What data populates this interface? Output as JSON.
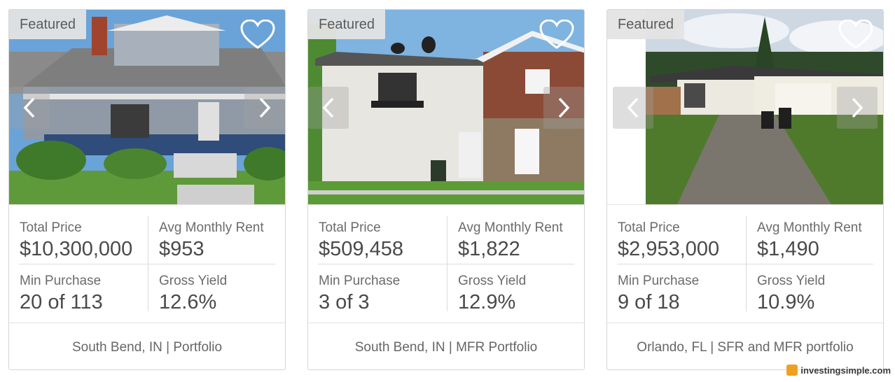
{
  "cards": [
    {
      "badge": "Featured",
      "total_price_label": "Total Price",
      "total_price": "$10,300,000",
      "rent_label": "Avg Monthly Rent",
      "rent": "$953",
      "min_purchase_label": "Min Purchase",
      "min_purchase": "20 of 113",
      "yield_label": "Gross Yield",
      "yield": "12.6%",
      "location": "South Bend, IN | Portfolio"
    },
    {
      "badge": "Featured",
      "total_price_label": "Total Price",
      "total_price": "$509,458",
      "rent_label": "Avg Monthly Rent",
      "rent": "$1,822",
      "min_purchase_label": "Min Purchase",
      "min_purchase": "3 of 3",
      "yield_label": "Gross Yield",
      "yield": "12.9%",
      "location": "South Bend, IN | MFR Portfolio"
    },
    {
      "badge": "Featured",
      "total_price_label": "Total Price",
      "total_price": "$2,953,000",
      "rent_label": "Avg Monthly Rent",
      "rent": "$1,490",
      "min_purchase_label": "Min Purchase",
      "min_purchase": "9 of 18",
      "yield_label": "Gross Yield",
      "yield": "10.9%",
      "location": "Orlando, FL | SFR and MFR portfolio"
    }
  ],
  "watermark": "investingsimple.com",
  "icons": {
    "favorite": "heart-outline-icon",
    "prev": "chevron-left-icon",
    "next": "chevron-right-icon"
  }
}
